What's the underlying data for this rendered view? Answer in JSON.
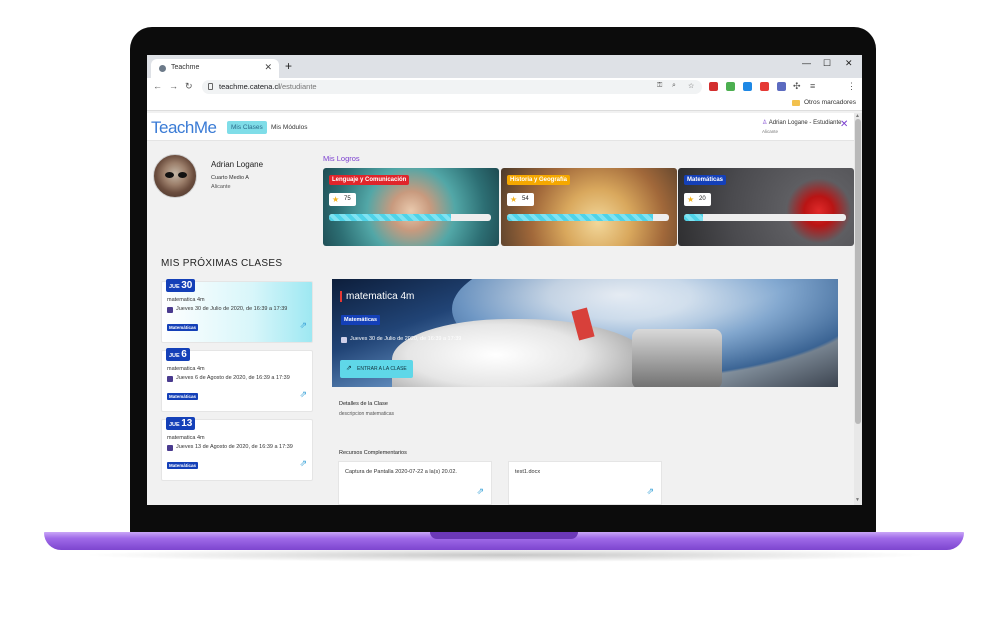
{
  "browser": {
    "tab_title": "Teachme",
    "url_host": "teachme.catena.cl",
    "url_path": "/estudiante",
    "bookmark_folder": "Otros marcadores"
  },
  "app": {
    "logo": "TeachMe",
    "nav": [
      "Mis Clases",
      "Mis Módulos"
    ],
    "user_label": "Adrian Logane - Estudiante",
    "user_sub": "Alicante"
  },
  "profile": {
    "name": "Adrian Logane",
    "grade": "Cuarto Medio A",
    "role": "Alicante"
  },
  "achievements": {
    "title": "Mis Logros",
    "cards": [
      {
        "label": "Lenguaje y Comunicación",
        "score": "75",
        "progress": 0.75,
        "tag_color": "#e0252b"
      },
      {
        "label": "Historia y Geografía",
        "score": "54",
        "progress": 0.9,
        "tag_color": "#f5a800"
      },
      {
        "label": "Matemáticas",
        "score": "20",
        "progress": 0.12,
        "tag_color": "#1440b8"
      }
    ]
  },
  "upcoming": {
    "title": "MIS PRÓXIMAS CLASES",
    "items": [
      {
        "day": "JUE",
        "num": "30",
        "name": "matematica 4m",
        "when": "Jueves 30 de Julio de 2020, de 16:39 a 17:39",
        "subject": "Matemáticas"
      },
      {
        "day": "JUE",
        "num": "6",
        "name": "matematica 4m",
        "when": "Jueves 6 de Agosto de 2020, de 16:39 a 17:39",
        "subject": "Matemáticas"
      },
      {
        "day": "JUE",
        "num": "13",
        "name": "matematica 4m",
        "when": "Jueves 13 de Agosto de 2020, de 16:39 a 17:39",
        "subject": "Matemáticas"
      }
    ]
  },
  "hero": {
    "title": "matematica 4m",
    "subject": "Matemáticas",
    "when": "Jueves 30 de Julio de 2020, de 16:39 a 17:39",
    "enter_label": "ENTRAR A LA CLASE"
  },
  "details": {
    "title": "Detalles de la Clase",
    "description": "descripcion matematicas"
  },
  "resources": {
    "title": "Recursos Complementarios",
    "items": [
      "Captura de Pantalla 2020-07-22 a la(s) 20.02.",
      "test1.docx"
    ]
  },
  "colors": {
    "accent_purple": "#7b3fd0",
    "brand_blue": "#1440b8",
    "cyan": "#5fd7e8"
  }
}
